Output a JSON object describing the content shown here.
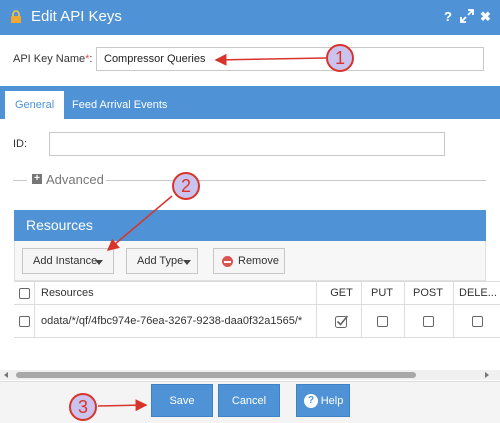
{
  "dialog": {
    "title": "Edit API Keys",
    "help_glyph": "?",
    "close_glyph": "✖"
  },
  "form": {
    "name_label": "API Key Name",
    "required_marker": "*",
    "name_colon": ":",
    "name_value": "Compressor Queries",
    "id_label": "ID:",
    "id_value": ""
  },
  "tabs": [
    {
      "label": "General",
      "active": true
    },
    {
      "label": "Feed Arrival Events",
      "active": false
    }
  ],
  "advanced": {
    "label": "Advanced",
    "expanded": false,
    "toggle_glyph": "+"
  },
  "resources": {
    "title": "Resources",
    "toolbar": {
      "add_instance_label": "Add Instance",
      "add_type_label": "Add Type",
      "remove_label": "Remove"
    },
    "columns": [
      "Resources",
      "GET",
      "PUT",
      "POST",
      "DELE..."
    ],
    "rows": [
      {
        "selected": false,
        "resource": "odata/*/qf/4fbc974e-76ea-3267-9238-daa0f32a1565/*",
        "get": true,
        "put": false,
        "post": false,
        "delete": false
      }
    ]
  },
  "footer": {
    "save_label": "Save",
    "cancel_label": "Cancel",
    "help_label": "Help",
    "help_glyph": "?"
  },
  "annotations": [
    "1",
    "2",
    "3"
  ],
  "colors": {
    "brand": "#4f93d6",
    "annotation_red": "#d9342b",
    "annotation_fill": "#c9c3ee"
  }
}
